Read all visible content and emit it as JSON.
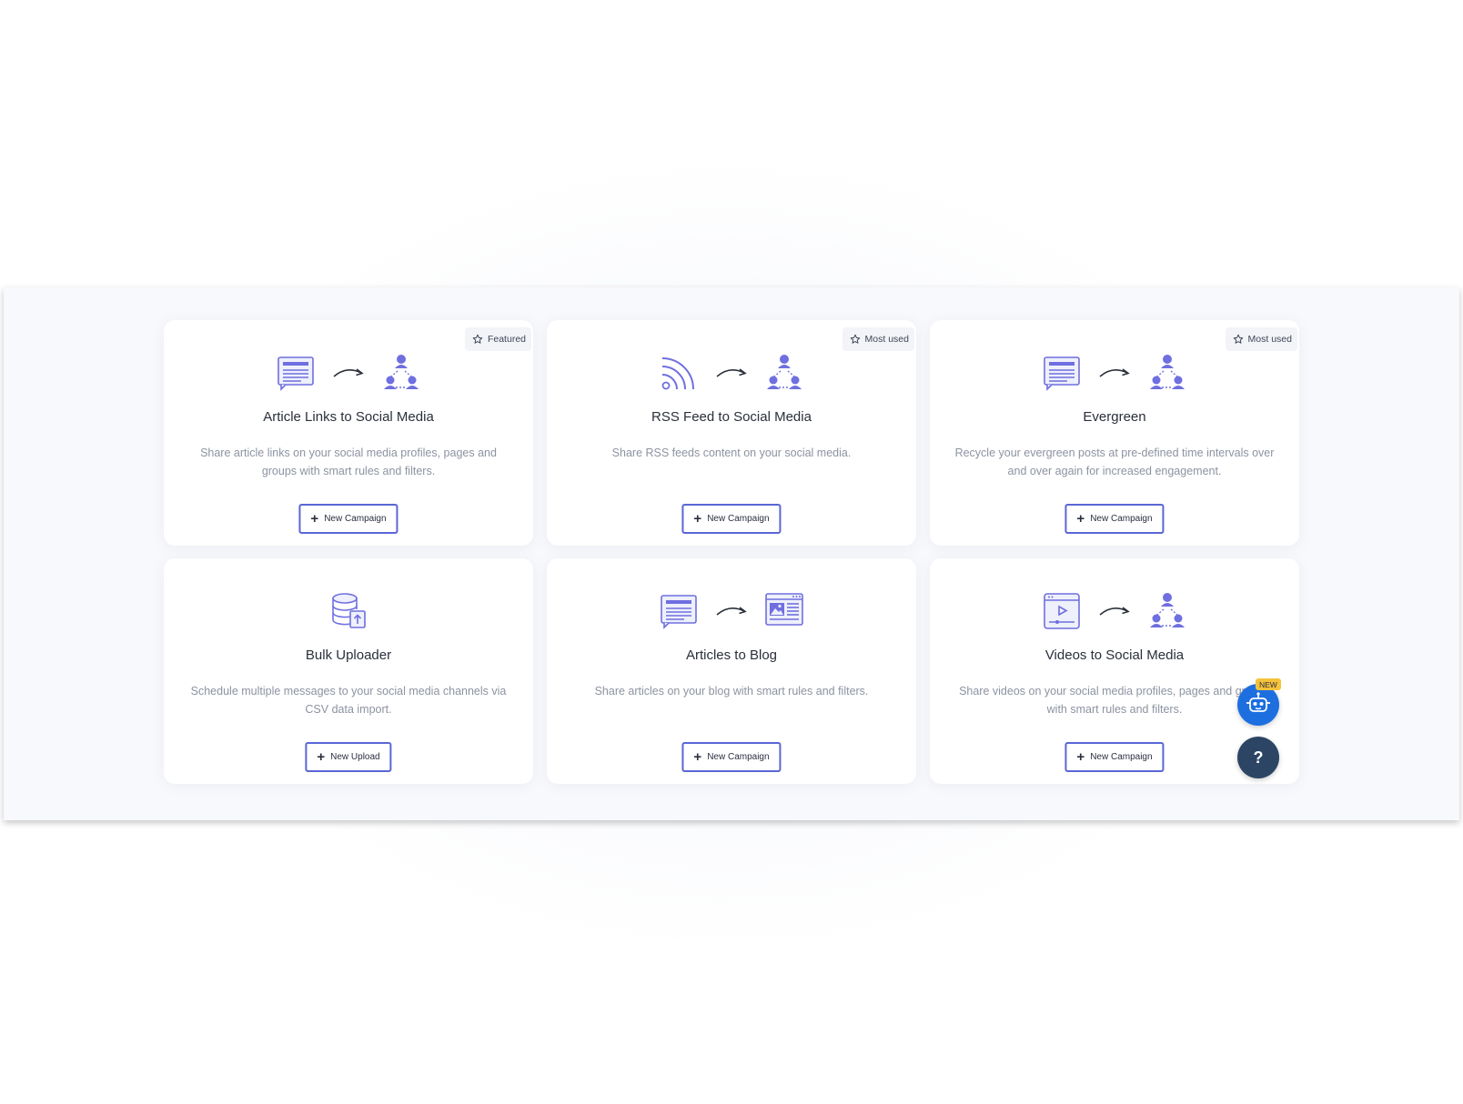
{
  "cards": [
    {
      "badge": "Featured",
      "title": "Article Links to Social Media",
      "desc": "Share article links on your social media profiles, pages and groups with smart rules and filters.",
      "button": "New Campaign",
      "icons": [
        "article-icon",
        "arrow-icon",
        "social-network-icon"
      ]
    },
    {
      "badge": "Most used",
      "title": "RSS Feed to Social Media",
      "desc": "Share RSS feeds content on your social media.",
      "button": "New Campaign",
      "icons": [
        "rss-icon",
        "arrow-icon",
        "social-network-icon"
      ]
    },
    {
      "badge": "Most used",
      "title": "Evergreen",
      "desc": "Recycle your evergreen posts at pre-defined time intervals over and over again for increased engagement.",
      "button": "New Campaign",
      "icons": [
        "article-icon",
        "arrow-icon",
        "social-network-icon"
      ]
    },
    {
      "title": "Bulk Uploader",
      "desc": "Schedule multiple messages to your social media channels via CSV data import.",
      "button": "New Upload",
      "icons": [
        "database-upload-icon"
      ]
    },
    {
      "title": "Articles to Blog",
      "desc": "Share articles on your blog with smart rules and filters.",
      "button": "New Campaign",
      "icons": [
        "article-icon",
        "arrow-icon",
        "blog-icon"
      ]
    },
    {
      "title": "Videos to Social Media",
      "desc": "Share videos on your social media profiles, pages and groups with smart rules and filters.",
      "button": "New Campaign",
      "icons": [
        "video-icon",
        "arrow-icon",
        "social-network-icon"
      ]
    }
  ],
  "widgets": {
    "new_label": "NEW",
    "help_label": "?",
    "bot_icon": "robot-icon"
  },
  "colors": {
    "accent": "#5a66d6",
    "icon_purple": "#6f6fe0",
    "bot_blue": "#1d6fe0",
    "help_navy": "#2c4564",
    "new_yellow": "#f5c23c"
  }
}
